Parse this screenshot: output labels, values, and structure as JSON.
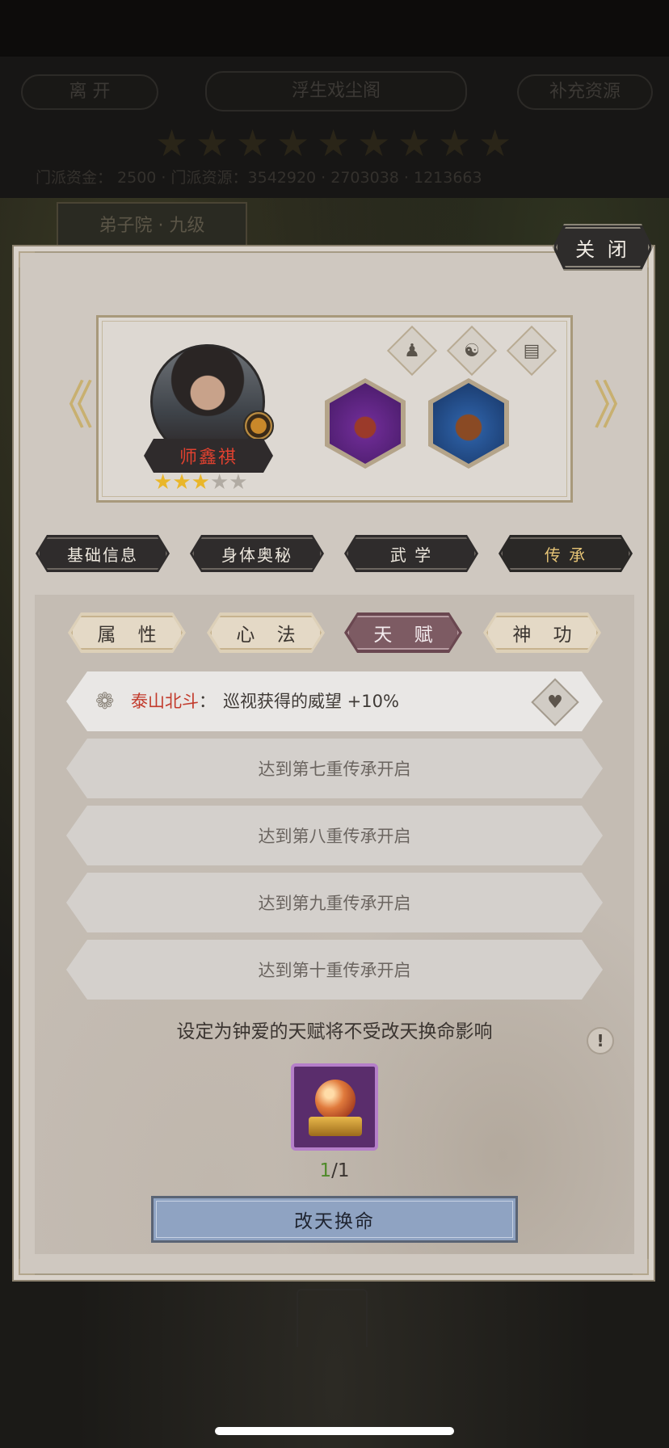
{
  "background": {
    "leave_label": "离 开",
    "scene_title": "浮生戏尘阁",
    "resupply_label": "补充资源",
    "stars_count": 9,
    "resources_text": "门派资金：  2500  ·  门派资源：3542920  ·  2703038  ·  1213663",
    "tab_label": "弟子院 · 九级"
  },
  "dialog": {
    "close_label": "关 闭"
  },
  "character": {
    "name": "师鑫祺",
    "stars_filled": 3,
    "stars_total": 5,
    "top_icons": [
      "chess-piece-icon",
      "yin-yang-icon",
      "scroll-book-icon"
    ],
    "equipment": [
      {
        "name": "claw-weapon-icon",
        "frame_color": "#7a3aa8"
      },
      {
        "name": "horse-mount-icon",
        "frame_color": "#3f78c4"
      }
    ],
    "prev_label": "《",
    "next_label": "》"
  },
  "main_tabs": [
    {
      "label": "基础信息",
      "active": false
    },
    {
      "label": "身体奥秘",
      "active": false
    },
    {
      "label": "武 学",
      "active": false
    },
    {
      "label": "传 承",
      "active": true
    }
  ],
  "sub_tabs": [
    {
      "label": "属 性",
      "active": false
    },
    {
      "label": "心 法",
      "active": false
    },
    {
      "label": "天 赋",
      "active": true
    },
    {
      "label": "神 功",
      "active": false
    }
  ],
  "talents": {
    "unlocked": {
      "name": "泰山北斗",
      "separator": "：",
      "description": "巡视获得的威望 +10%"
    },
    "locked": [
      "达到第七重传承开启",
      "达到第八重传承开启",
      "达到第九重传承开启",
      "达到第十重传承开启"
    ]
  },
  "hint": "设定为钟爱的天赋将不受改天换命影响",
  "item": {
    "current": "1",
    "total": "/1"
  },
  "change_fate_label": "改天换命",
  "colors": {
    "accent_gold": "#e6c476",
    "active_subtab": "#6a4750",
    "talent_name": "#c23a2b",
    "button_blue": "#8fa3c2"
  }
}
